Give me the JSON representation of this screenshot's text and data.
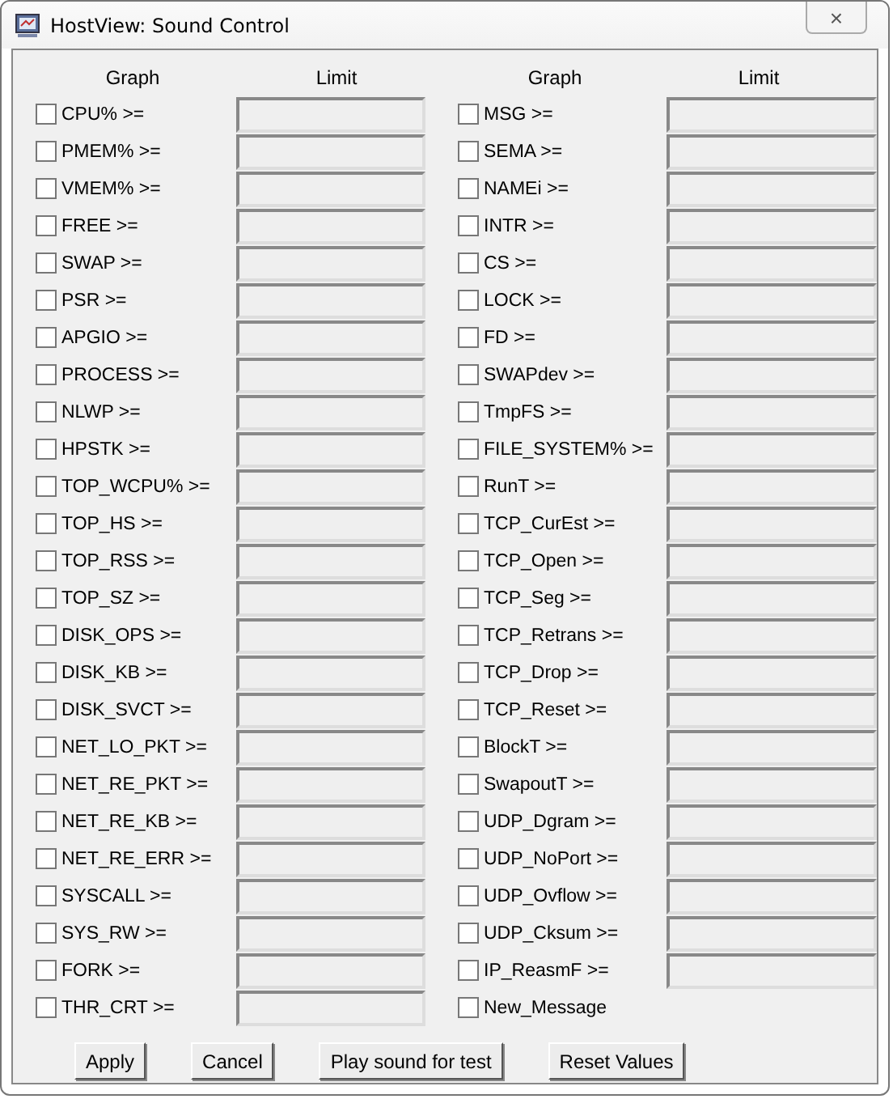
{
  "window": {
    "title": "HostView: Sound Control",
    "close": "×"
  },
  "columns": [
    {
      "headers": [
        "Graph",
        "Limit"
      ],
      "items": [
        {
          "label": "CPU% >=",
          "checked": false,
          "kind": "limit"
        },
        {
          "label": "PMEM% >=",
          "checked": false,
          "kind": "limit"
        },
        {
          "label": "VMEM% >=",
          "checked": false,
          "kind": "limit"
        },
        {
          "label": "FREE >=",
          "checked": false,
          "kind": "limit"
        },
        {
          "label": "SWAP >=",
          "checked": false,
          "kind": "limit"
        },
        {
          "label": "PSR >=",
          "checked": false,
          "kind": "limit"
        },
        {
          "label": "APGIO >=",
          "checked": false,
          "kind": "limit"
        },
        {
          "label": "PROCESS >=",
          "checked": false,
          "kind": "limit"
        },
        {
          "label": "NLWP >=",
          "checked": false,
          "kind": "limit"
        },
        {
          "label": "HPSTK >=",
          "checked": false,
          "kind": "limit"
        },
        {
          "label": "TOP_WCPU% >=",
          "checked": false,
          "kind": "limit"
        },
        {
          "label": "TOP_HS >=",
          "checked": false,
          "kind": "limit"
        },
        {
          "label": "TOP_RSS >=",
          "checked": false,
          "kind": "limit"
        },
        {
          "label": "TOP_SZ >=",
          "checked": false,
          "kind": "limit"
        },
        {
          "label": "DISK_OPS >=",
          "checked": false,
          "kind": "limit"
        },
        {
          "label": "DISK_KB >=",
          "checked": false,
          "kind": "limit"
        },
        {
          "label": "DISK_SVCT >=",
          "checked": false,
          "kind": "limit"
        },
        {
          "label": "NET_LO_PKT >=",
          "checked": false,
          "kind": "limit"
        },
        {
          "label": "NET_RE_PKT >=",
          "checked": false,
          "kind": "limit"
        },
        {
          "label": "NET_RE_KB >=",
          "checked": false,
          "kind": "limit"
        },
        {
          "label": "NET_RE_ERR >=",
          "checked": false,
          "kind": "limit"
        },
        {
          "label": "SYSCALL >=",
          "checked": false,
          "kind": "limit"
        },
        {
          "label": "SYS_RW >=",
          "checked": false,
          "kind": "limit"
        },
        {
          "label": "FORK >=",
          "checked": false,
          "kind": "limit"
        },
        {
          "label": "THR_CRT >=",
          "checked": false,
          "kind": "limit"
        }
      ]
    },
    {
      "headers": [
        "Graph",
        "Limit"
      ],
      "items": [
        {
          "label": "MSG >=",
          "checked": false,
          "kind": "limit"
        },
        {
          "label": "SEMA >=",
          "checked": false,
          "kind": "limit"
        },
        {
          "label": "NAMEi >=",
          "checked": false,
          "kind": "limit"
        },
        {
          "label": "INTR >=",
          "checked": false,
          "kind": "limit"
        },
        {
          "label": "CS >=",
          "checked": false,
          "kind": "limit"
        },
        {
          "label": "LOCK >=",
          "checked": false,
          "kind": "limit"
        },
        {
          "label": "FD >=",
          "checked": false,
          "kind": "limit"
        },
        {
          "label": "SWAPdev >=",
          "checked": false,
          "kind": "limit"
        },
        {
          "label": "TmpFS >=",
          "checked": false,
          "kind": "limit"
        },
        {
          "label": "FILE_SYSTEM% >=",
          "checked": false,
          "kind": "limit"
        },
        {
          "label": "RunT >=",
          "checked": false,
          "kind": "limit"
        },
        {
          "label": "TCP_CurEst >=",
          "checked": false,
          "kind": "limit"
        },
        {
          "label": "TCP_Open >=",
          "checked": false,
          "kind": "limit"
        },
        {
          "label": "TCP_Seg >=",
          "checked": false,
          "kind": "limit"
        },
        {
          "label": "TCP_Retrans >=",
          "checked": false,
          "kind": "limit"
        },
        {
          "label": "TCP_Drop >=",
          "checked": false,
          "kind": "limit"
        },
        {
          "label": "TCP_Reset >=",
          "checked": false,
          "kind": "limit"
        },
        {
          "label": "BlockT >=",
          "checked": false,
          "kind": "limit"
        },
        {
          "label": "SwapoutT >=",
          "checked": false,
          "kind": "limit"
        },
        {
          "label": "UDP_Dgram >=",
          "checked": false,
          "kind": "limit"
        },
        {
          "label": "UDP_NoPort >=",
          "checked": false,
          "kind": "limit"
        },
        {
          "label": "UDP_Ovflow >=",
          "checked": false,
          "kind": "limit"
        },
        {
          "label": "UDP_Cksum >=",
          "checked": false,
          "kind": "limit"
        },
        {
          "label": "IP_ReasmF >=",
          "checked": false,
          "kind": "limit"
        },
        {
          "label": "New_Message",
          "checked": false,
          "kind": "plain"
        }
      ]
    }
  ],
  "buttons": [
    "Apply",
    "Cancel",
    "Play sound for test",
    "Reset Values"
  ]
}
